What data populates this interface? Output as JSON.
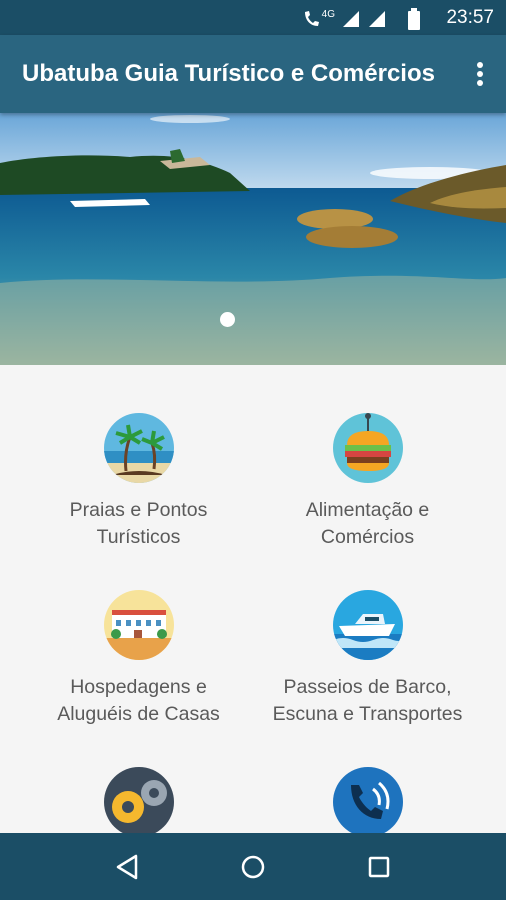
{
  "status_bar": {
    "time": "23:57",
    "network": "4G"
  },
  "app_bar": {
    "title": "Ubatuba Guia Turístico e Comércios",
    "menu_icon": "more-vert-icon"
  },
  "carousel": {
    "active_index": 0,
    "slides": 1
  },
  "categories": [
    {
      "line1": "Praias e Pontos",
      "line2": "Turísticos",
      "icon": "beach-icon"
    },
    {
      "line1": "Alimentação e",
      "line2": "Comércios",
      "icon": "burger-icon"
    },
    {
      "line1": "Hospedagens e",
      "line2": "Aluguéis de Casas",
      "icon": "hotel-icon"
    },
    {
      "line1": "Passeios de Barco,",
      "line2": "Escuna e Transportes",
      "icon": "boat-icon"
    },
    {
      "line1": "",
      "line2": "",
      "icon": "gears-icon"
    },
    {
      "line1": "",
      "line2": "",
      "icon": "phone-icon"
    }
  ],
  "colors": {
    "status_bar": "#1b4e66",
    "app_bar": "#2a6580",
    "nav_bar": "#1b4e66",
    "label_text": "#5a5a5a"
  }
}
